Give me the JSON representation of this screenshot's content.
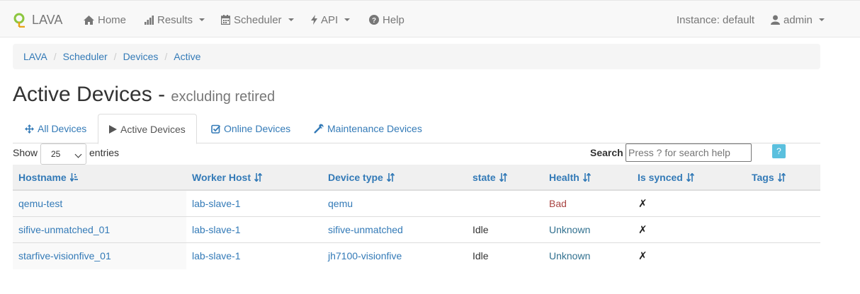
{
  "navbar": {
    "brand": "LAVA",
    "items": [
      {
        "label": "Home",
        "icon": "home-icon"
      },
      {
        "label": "Results",
        "icon": "bar-chart-icon"
      },
      {
        "label": "Scheduler",
        "icon": "calendar-icon"
      },
      {
        "label": "API",
        "icon": "flash-icon"
      },
      {
        "label": "Help",
        "icon": "question-circle-icon"
      }
    ],
    "instance": "Instance: default",
    "user": "admin",
    "user_icon": "user-icon"
  },
  "breadcrumb": [
    "LAVA",
    "Scheduler",
    "Devices",
    "Active"
  ],
  "title": {
    "main": "Active Devices",
    "separator": " - ",
    "sub": "excluding retired"
  },
  "tabs": [
    {
      "label": "All Devices",
      "icon": "move-icon",
      "active": false
    },
    {
      "label": "Active Devices",
      "icon": "play-icon",
      "active": true
    },
    {
      "label": "Online Devices",
      "icon": "check-square-icon",
      "active": false
    },
    {
      "label": "Maintenance Devices",
      "icon": "wrench-icon",
      "active": false
    }
  ],
  "controls": {
    "show_label": "Show",
    "page_length": "25",
    "entries_label": "entries",
    "search_label": "Search",
    "search_placeholder": "Press ? for search help",
    "help_label": "?"
  },
  "table": {
    "columns": [
      "Hostname",
      "Worker Host",
      "Device type",
      "state",
      "Health",
      "Is synced",
      "Tags"
    ],
    "rows": [
      {
        "hostname": "qemu-test",
        "worker": "lab-slave-1",
        "device_type": "qemu",
        "state": "",
        "health": "Bad",
        "synced": "✗",
        "tags": ""
      },
      {
        "hostname": "sifive-unmatched_01",
        "worker": "lab-slave-1",
        "device_type": "sifive-unmatched",
        "state": "Idle",
        "health": "Unknown",
        "synced": "✗",
        "tags": ""
      },
      {
        "hostname": "starfive-visionfive_01",
        "worker": "lab-slave-1",
        "device_type": "jh7100-visionfive",
        "state": "Idle",
        "health": "Unknown",
        "synced": "✗",
        "tags": ""
      }
    ]
  },
  "colors": {
    "link": "#337ab7",
    "health_bad": "#a94442",
    "health_unknown": "#31708f",
    "brand_green": "#8cc63f",
    "help_button": "#5bc0de"
  }
}
